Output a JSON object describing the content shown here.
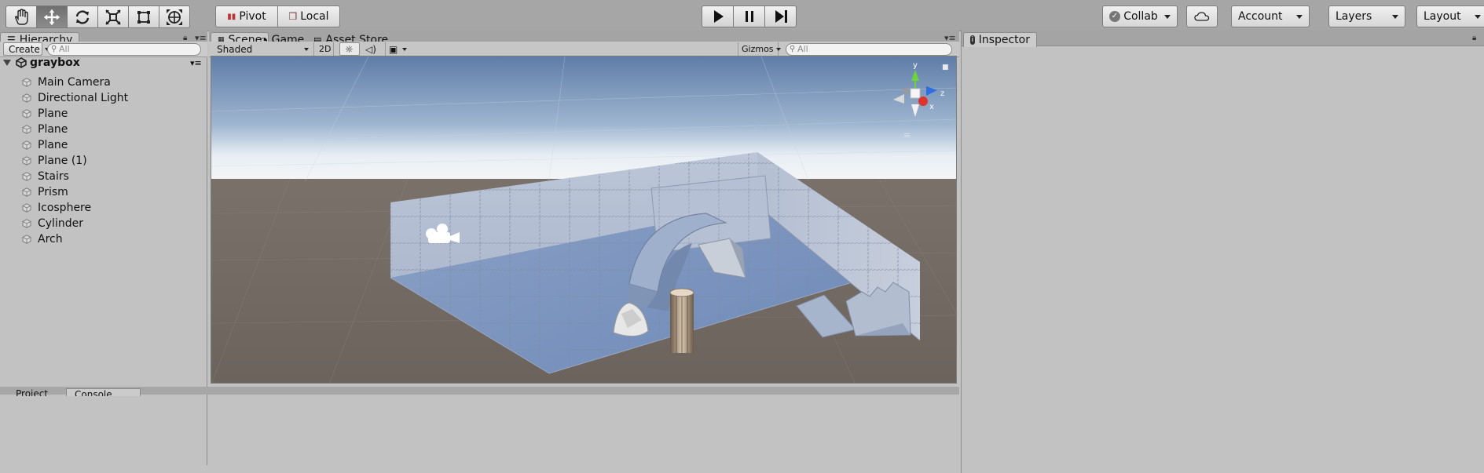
{
  "toolbar": {
    "tools": [
      "hand-icon",
      "move-icon",
      "rotate-icon",
      "scale-icon",
      "rect-tool-icon",
      "transform-icon"
    ],
    "pivot_label": "Pivot",
    "local_label": "Local",
    "collab_label": "Collab",
    "account_label": "Account",
    "layers_label": "Layers",
    "layout_label": "Layout"
  },
  "hierarchy": {
    "tab_label": "Hierarchy",
    "create_label": "Create",
    "search_placeholder": "All",
    "scene_name": "graybox",
    "items": [
      {
        "label": "Main Camera"
      },
      {
        "label": "Directional Light"
      },
      {
        "label": "Plane"
      },
      {
        "label": "Plane"
      },
      {
        "label": "Plane"
      },
      {
        "label": "Plane (1)"
      },
      {
        "label": "Stairs"
      },
      {
        "label": "Prism"
      },
      {
        "label": "Icosphere"
      },
      {
        "label": "Cylinder"
      },
      {
        "label": "Arch"
      }
    ]
  },
  "scene": {
    "tabs": [
      {
        "label": "Scene"
      },
      {
        "label": "Game"
      },
      {
        "label": "Asset Store"
      }
    ],
    "shading_mode": "Shaded",
    "mode_2d": "2D",
    "gizmos_label": "Gizmos",
    "search_placeholder": "All",
    "axis_y": "y",
    "axis_z": "z",
    "axis_x": "x"
  },
  "inspector": {
    "tab_label": "Inspector"
  },
  "bottom": {
    "tab1": "Project",
    "tab2": "Console"
  },
  "colors": {
    "toolbar_bg": "#a6a6a6",
    "panel_bg": "#c2c2c2",
    "sky_top": "#5a7aa6",
    "ground": "#6d6660"
  }
}
